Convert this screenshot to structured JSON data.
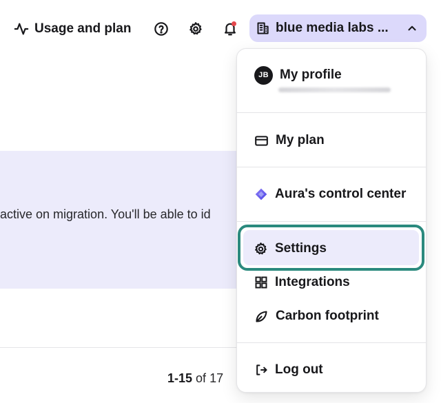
{
  "header": {
    "usage_label": "Usage and plan",
    "org_name": "blue media labs ...",
    "icons": {
      "usage": "activity-icon",
      "help": "help-circle-icon",
      "settings": "gear-icon",
      "notifications": "bell-icon",
      "org": "building-icon",
      "chevron": "chevron-up-icon"
    },
    "notification_dot_color": "#e5484d",
    "org_chip_color": "#dcd9fb"
  },
  "background": {
    "banner_text": "active on migration. You'll be able to id",
    "pagination": {
      "range": "1-15",
      "of_label": "of",
      "total": "17"
    }
  },
  "menu": {
    "profile": {
      "avatar_initials": "JB",
      "label": "My profile"
    },
    "items": [
      {
        "key": "plan",
        "label": "My plan",
        "icon": "credit-card-icon"
      },
      {
        "key": "aura",
        "label": "Aura's control center",
        "icon": "aura-diamond-icon"
      },
      {
        "key": "settings",
        "label": "Settings",
        "icon": "gear-icon",
        "highlighted": true
      },
      {
        "key": "integrations",
        "label": "Integrations",
        "icon": "grid-icon"
      },
      {
        "key": "carbon",
        "label": "Carbon footprint",
        "icon": "leaf-icon"
      },
      {
        "key": "logout",
        "label": "Log out",
        "icon": "log-out-icon"
      }
    ],
    "highlight_color": "#2b8a7e",
    "selected_bg": "#ecebfb"
  }
}
